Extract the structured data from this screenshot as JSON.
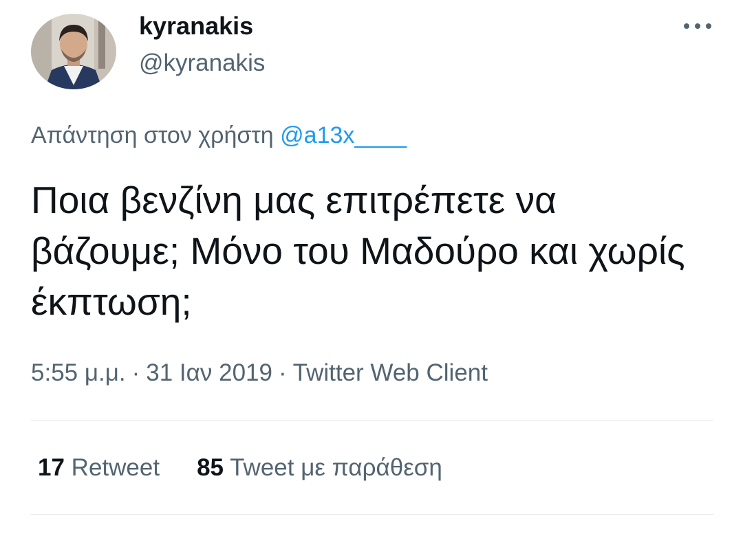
{
  "user": {
    "display_name": "kyranakis",
    "handle": "@kyranakis"
  },
  "more_icon": "more-horizontal-icon",
  "reply": {
    "prefix": "Απάντηση στον χρήστη",
    "mention": "@a13x____"
  },
  "tweet": {
    "text": "Ποια βενζίνη μας επιτρέπετε να βάζουμε; Μόνο του Μαδούρο και χωρίς έκπτωση;"
  },
  "meta": {
    "time": "5:55 μ.μ.",
    "date": "31 Ιαν 2019",
    "client": "Twitter Web Client",
    "separator": "·"
  },
  "stats": {
    "retweets_count": "17",
    "retweets_label": "Retweet",
    "quotes_count": "85",
    "quotes_label": "Tweet με παράθεση"
  },
  "colors": {
    "text_primary": "#0f1419",
    "text_secondary": "#536471",
    "link": "#1d9bf0",
    "divider": "#e4e7ea"
  }
}
